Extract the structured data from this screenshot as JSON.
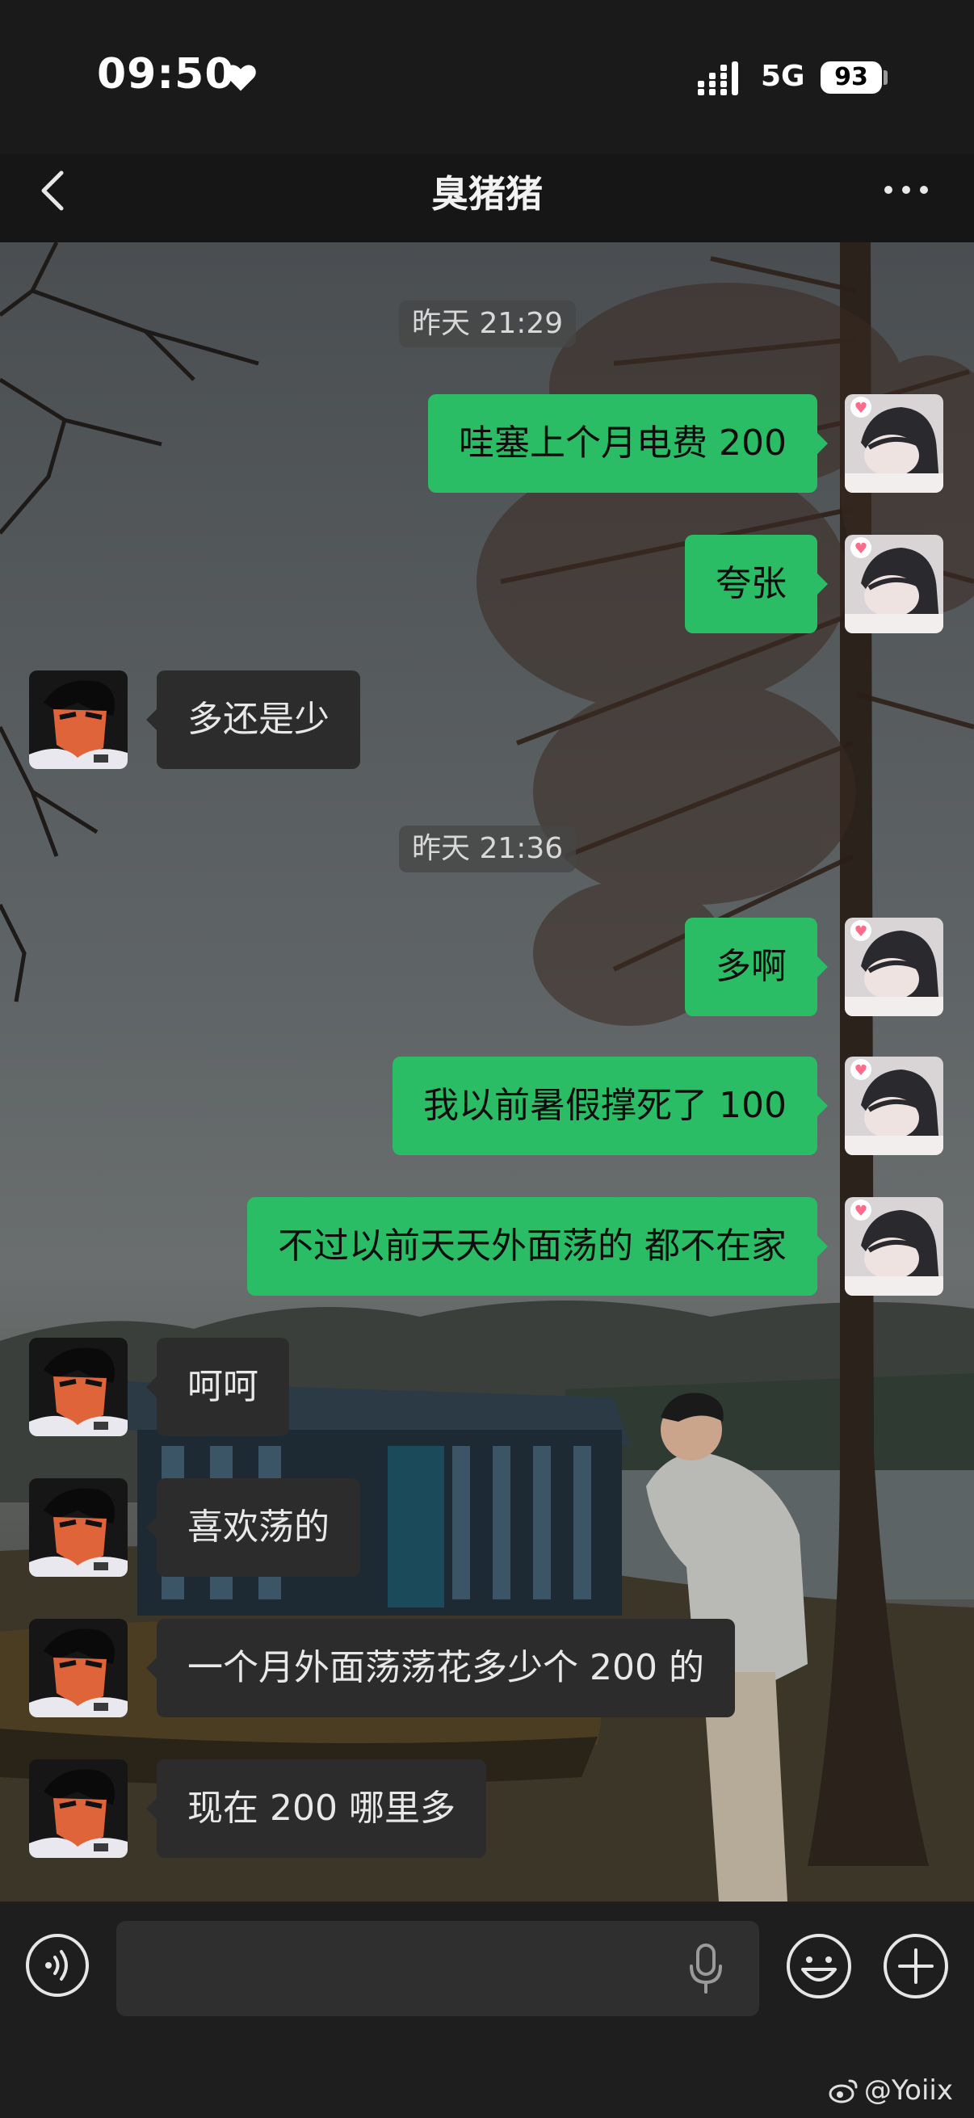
{
  "status_bar": {
    "time": "09:50",
    "network": "5G",
    "battery": "93"
  },
  "header": {
    "title": "臭猪猪"
  },
  "messages": [
    {
      "type": "time",
      "text": "昨天 21:29"
    },
    {
      "type": "msg",
      "side": "me",
      "text": "哇塞上个月电费 200"
    },
    {
      "type": "msg",
      "side": "me",
      "text": "夸张"
    },
    {
      "type": "msg",
      "side": "them",
      "text": "多还是少"
    },
    {
      "type": "time",
      "text": "昨天 21:36"
    },
    {
      "type": "msg",
      "side": "me",
      "text": "多啊"
    },
    {
      "type": "msg",
      "side": "me",
      "text": "我以前暑假撑死了 100"
    },
    {
      "type": "msg",
      "side": "me",
      "text": "不过以前天天外面荡的 都不在家"
    },
    {
      "type": "msg",
      "side": "them",
      "text": "呵呵"
    },
    {
      "type": "msg",
      "side": "them",
      "text": "喜欢荡的"
    },
    {
      "type": "msg",
      "side": "them",
      "text": "一个月外面荡荡花多少个 200 的"
    },
    {
      "type": "msg",
      "side": "them",
      "text": "现在 200 哪里多"
    }
  ],
  "input": {
    "value": ""
  },
  "watermark": {
    "text": "@Yoiix"
  },
  "colors": {
    "my_bubble": "#2bbd66",
    "their_bubble": "#2c2c2c",
    "input_bar": "#1e1e1e"
  },
  "icons": [
    "heart-icon",
    "signal-icon",
    "back-icon",
    "more-icon",
    "voice-icon",
    "mic-icon",
    "emoji-icon",
    "plus-icon",
    "weibo-icon"
  ]
}
